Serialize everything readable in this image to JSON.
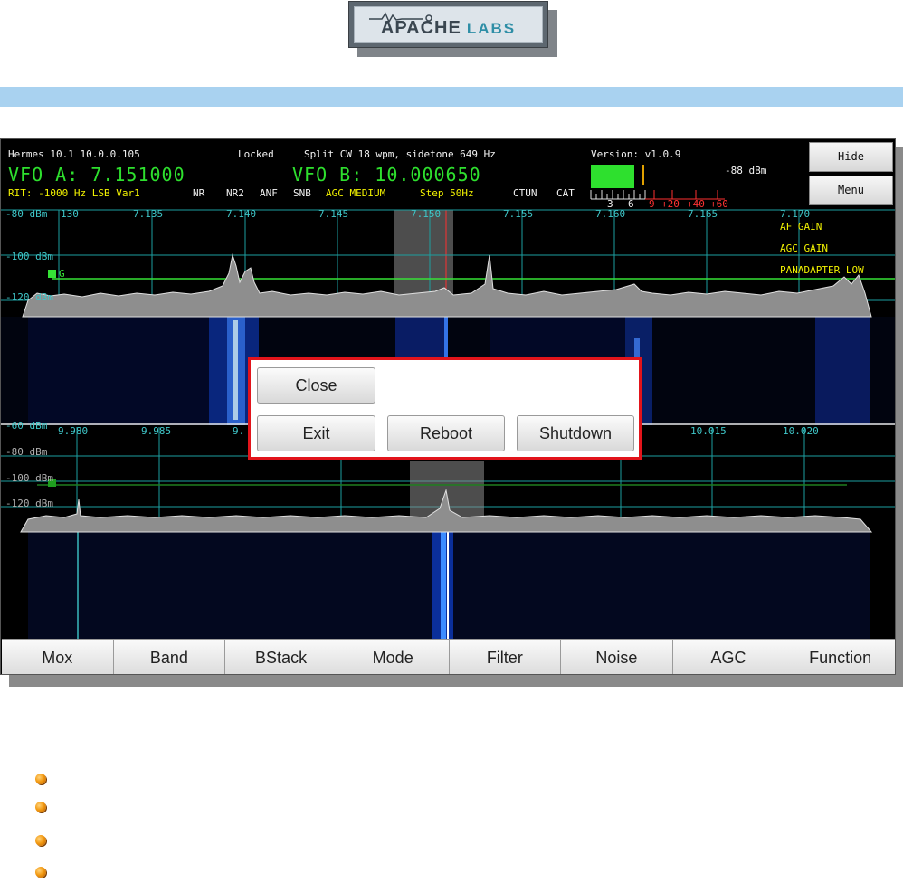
{
  "logo": {
    "brand": "APACHE",
    "suffix": "LABS"
  },
  "status": {
    "radio": "Hermes 10.1 10.0.0.105",
    "lock": "Locked",
    "mode_info": "Split CW 18 wpm, sidetone 649 Hz",
    "version": "Version: v1.0.9",
    "dbm": "-88 dBm"
  },
  "vfo": {
    "a": "VFO A: 7.151000",
    "b": "VFO B: 10.000650"
  },
  "info_line": {
    "rit": "RIT: -1000 Hz LSB Var1",
    "nr": "NR",
    "nr2": "NR2",
    "anf": "ANF",
    "snb": "SNB",
    "agc": "AGC MEDIUM",
    "step": "Step 50Hz",
    "ctun": "CTUN",
    "cat": "CAT"
  },
  "meter_scale": {
    "white": [
      "3",
      "6"
    ],
    "red": [
      "9",
      "+20",
      "+40",
      "+60"
    ]
  },
  "side_buttons": {
    "hide": "Hide",
    "menu": "Menu"
  },
  "panadapter_a": {
    "freq_labels": [
      "130",
      "7.135",
      "7.140",
      "7.145",
      "7.150",
      "7.155",
      "7.160",
      "7.165",
      "7.170"
    ],
    "dbm_labels": [
      "-80 dBm",
      "-100 dBm",
      "-120 dBm"
    ],
    "marker": "G",
    "menu_items": [
      "AF GAIN",
      "AGC GAIN",
      "PANADAPTER LOW"
    ]
  },
  "panadapter_b": {
    "freq_labels": [
      "-60 dBm",
      "9.980",
      "9.985",
      "9.",
      "10.015",
      "10.020"
    ],
    "dbm_labels": [
      "-80 dBm",
      "-100 dBm",
      "-120 dBm"
    ]
  },
  "dialog": {
    "close": "Close",
    "exit": "Exit",
    "reboot": "Reboot",
    "shutdown": "Shutdown"
  },
  "toolbar": [
    "Mox",
    "Band",
    "BStack",
    "Mode",
    "Filter",
    "Noise",
    "AGC",
    "Function"
  ],
  "colors": {
    "vfo": "#2ee02e",
    "grid": "#1d9ea0",
    "dialog_border": "#e2141b",
    "accent_bar": "#a9d2f0"
  }
}
